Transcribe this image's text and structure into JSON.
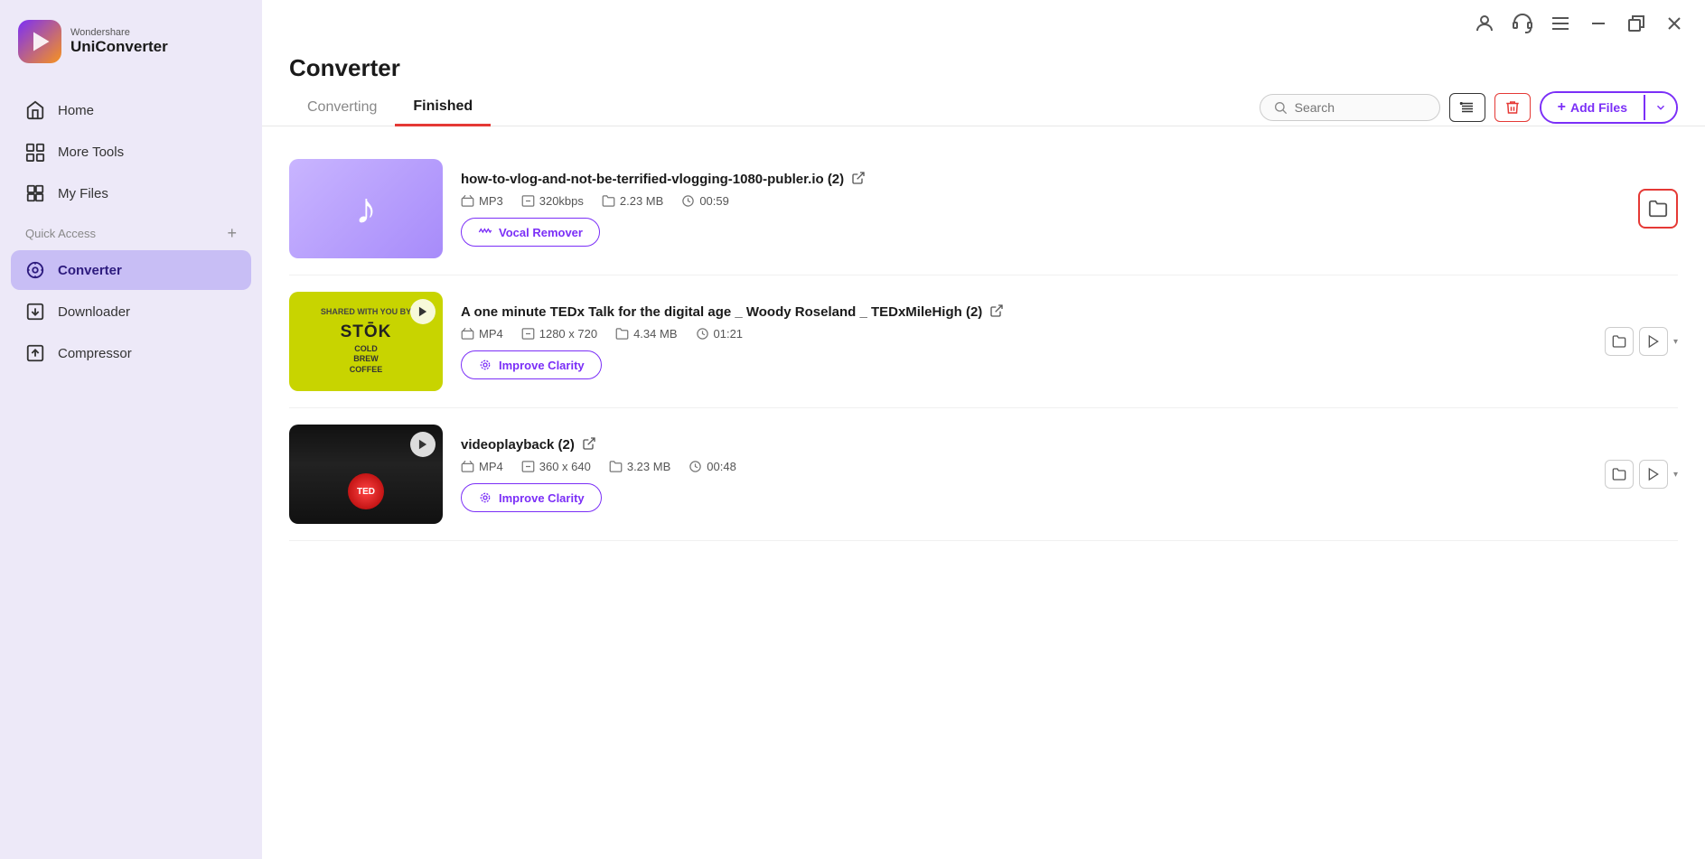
{
  "app": {
    "brand": "Wondershare",
    "product": "UniConverter"
  },
  "sidebar": {
    "items": [
      {
        "id": "home",
        "label": "Home",
        "active": false
      },
      {
        "id": "more-tools",
        "label": "More Tools",
        "active": false
      },
      {
        "id": "my-files",
        "label": "My Files",
        "active": false
      },
      {
        "id": "converter",
        "label": "Converter",
        "active": true
      },
      {
        "id": "downloader",
        "label": "Downloader",
        "active": false
      },
      {
        "id": "compressor",
        "label": "Compressor",
        "active": false
      }
    ],
    "quick_access_label": "Quick Access",
    "quick_access_plus": "+"
  },
  "topbar": {
    "profile_icon": "person-icon",
    "headset_icon": "headset-icon",
    "menu_icon": "menu-icon",
    "minimize_icon": "minimize-icon",
    "restore_icon": "restore-icon",
    "close_icon": "close-icon"
  },
  "converter": {
    "page_title": "Converter",
    "tabs": [
      {
        "id": "converting",
        "label": "Converting",
        "active": false
      },
      {
        "id": "finished",
        "label": "Finished",
        "active": true
      }
    ],
    "search_placeholder": "Search",
    "list_icon_label": "list-view",
    "delete_label": "delete",
    "add_files_label": "+ Add Files",
    "add_files_arrow": "▾",
    "files": [
      {
        "id": "file1",
        "name": "how-to-vlog-and-not-be-terrified-vlogging-1080-publer.io (2)",
        "type": "MP3",
        "bitrate": "320kbps",
        "size": "2.23 MB",
        "duration": "00:59",
        "action_label": "Vocal Remover",
        "action_icon": "vocal-icon",
        "thumb_type": "music",
        "folder_highlighted": true
      },
      {
        "id": "file2",
        "name": "A one minute TEDx Talk for the digital age _ Woody Roseland _ TEDxMileHigh (2)",
        "type": "MP4",
        "resolution": "1280 x 720",
        "size": "4.34 MB",
        "duration": "01:21",
        "action_label": "Improve Clarity",
        "action_icon": "clarity-icon",
        "thumb_type": "video-yellow",
        "folder_highlighted": false
      },
      {
        "id": "file3",
        "name": "videoplayback (2)",
        "type": "MP4",
        "resolution": "360 x 640",
        "size": "3.23 MB",
        "duration": "00:48",
        "action_label": "Improve Clarity",
        "action_icon": "clarity-icon",
        "thumb_type": "video-dark",
        "folder_highlighted": false
      }
    ]
  }
}
